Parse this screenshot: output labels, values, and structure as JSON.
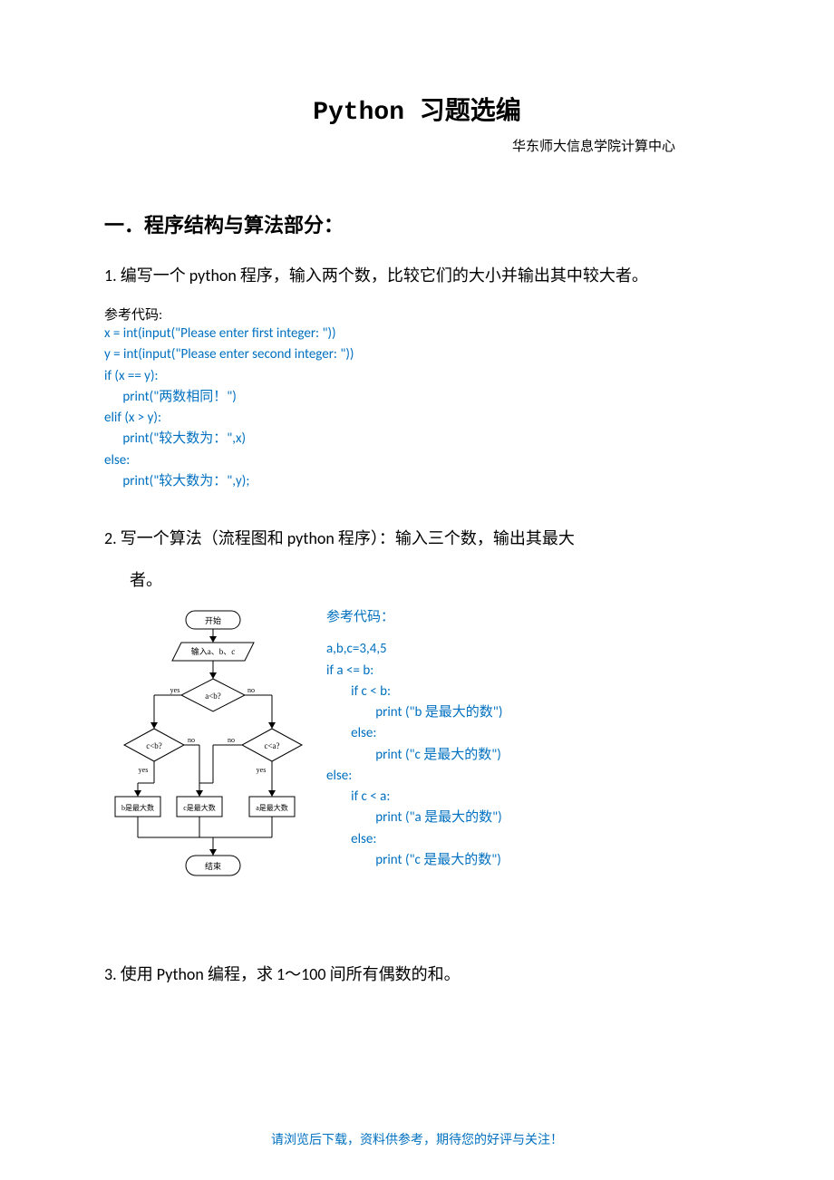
{
  "title": "Python 习题选编",
  "subtitle": "华东师大信息学院计算中心",
  "section1_heading": "一．程序结构与算法部分：",
  "problem1": "1.  编写一个 python 程序，输入两个数，比较它们的大小并输出其中较大者。",
  "reference_label": "参考代码:",
  "reference_label_colon": "参考代码：",
  "code1": "x = int(input(\"Please enter first integer: \"))\ny = int(input(\"Please enter second integer: \"))\nif (x == y):\n      print(\"两数相同！\")\nelif (x > y):\n      print(\"较大数为：\",x)\nelse:\n      print(\"较大数为：\",y);",
  "problem2": "2.  写一个算法（流程图和 python 程序）：输入三个数，输出其最大",
  "problem2_cont": "者。",
  "flowchart": {
    "start": "开始",
    "input": "输入a、b、c",
    "cond_ab": "a<b?",
    "cond_cb": "c<b?",
    "cond_ca": "c<a?",
    "yes": "yes",
    "no": "no",
    "out_b": "b是最大数",
    "out_c": "c是最大数",
    "out_a": "a是最大数",
    "end": "结束"
  },
  "code2": "a,b,c=3,4,5\nif a <= b:\n        if c < b:\n                print (\"b 是最大的数\")\n        else:\n                print (\"c 是最大的数\")\nelse:\n        if c < a:\n                print (\"a 是最大的数\")\n        else:\n                print (\"c 是最大的数\")",
  "problem3": "3.  使用 Python 编程，求 1～100 间所有偶数的和。",
  "footer": "请浏览后下载，资料供参考，期待您的好评与关注！"
}
